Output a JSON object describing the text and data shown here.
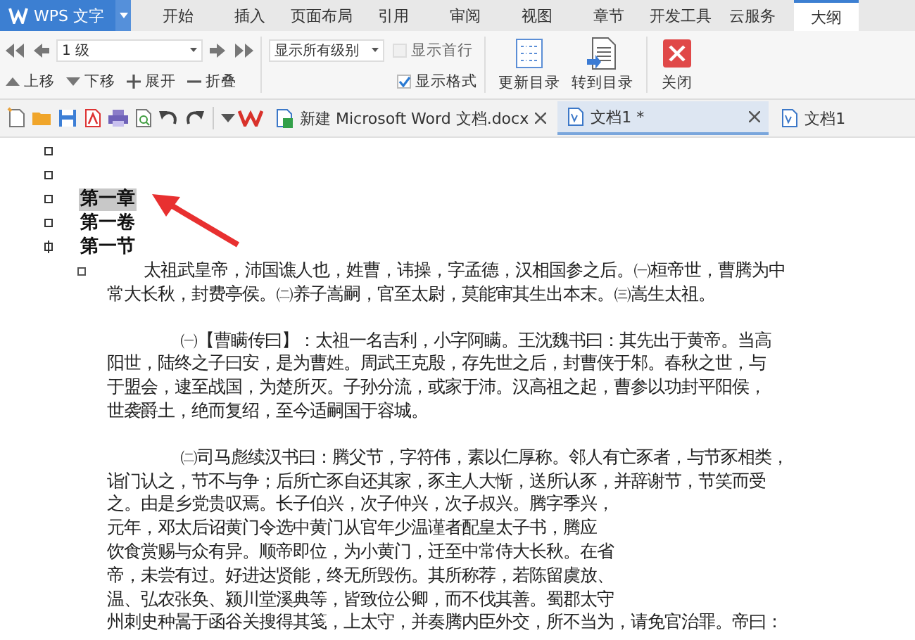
{
  "app_menu": {
    "label": "WPS 文字"
  },
  "ribbon_tabs": [
    {
      "label": "开始",
      "selected": false
    },
    {
      "label": "插入",
      "selected": false
    },
    {
      "label": "页面布局",
      "selected": false
    },
    {
      "label": "引用",
      "selected": false
    },
    {
      "label": "审阅",
      "selected": false
    },
    {
      "label": "视图",
      "selected": false
    },
    {
      "label": "章节",
      "selected": false
    },
    {
      "label": "开发工具",
      "selected": false
    },
    {
      "label": "云服务",
      "selected": false
    },
    {
      "label": "大纲",
      "selected": true
    }
  ],
  "outline_toolbar": {
    "level_select": {
      "value": "1 级"
    },
    "move_buttons": [
      {
        "kind": "up",
        "label": "上移"
      },
      {
        "kind": "down",
        "label": "下移"
      },
      {
        "kind": "expand",
        "label": "展开"
      },
      {
        "kind": "collapse",
        "label": "折叠"
      }
    ],
    "show_levels": {
      "value": "显示所有级别"
    },
    "checkboxes": [
      {
        "label": "显示首行",
        "checked": false,
        "disabled": true
      },
      {
        "label": "显示格式",
        "checked": true,
        "disabled": false
      }
    ],
    "big_buttons": [
      {
        "kind": "update",
        "label": "更新目录"
      },
      {
        "kind": "goto",
        "label": "转到目录"
      },
      {
        "kind": "close",
        "label": "关闭"
      }
    ]
  },
  "doc_tabs": [
    {
      "label": "新建 Microsoft Word 文档.docx",
      "selected": false,
      "closable": true
    },
    {
      "label": "文档1 *",
      "selected": true,
      "closable": true
    },
    {
      "label": "文档1",
      "selected": false,
      "closable": false
    }
  ],
  "outline": [
    {
      "kind": "empty"
    },
    {
      "kind": "empty"
    },
    {
      "kind": "heading",
      "text": "第一章",
      "selected": true
    },
    {
      "kind": "heading",
      "text": "第一卷",
      "selected": false
    },
    {
      "kind": "heading",
      "text": "第一节",
      "selected": false,
      "expandable": true
    },
    {
      "kind": "body",
      "paragraphs": [
        {
          "lines": [
            "太祖武皇帝，沛国谯人也，姓曹，讳操，字孟德，汉相国参之后。㈠桓帝世，曹腾为中",
            "常大长秋，封费亭侯。㈡养子嵩嗣，官至太尉，莫能审其生出本末。㈢嵩生太祖。"
          ]
        },
        {
          "lines": [
            "㈠【曹瞒传曰】：太祖一名吉利，小字阿瞒。王沈魏书曰：其先出于黄帝。当高",
            "阳世，陆终之子曰安，是为曹姓。周武王克殷，存先世之后，封曹侠于邾。春秋之世，与",
            "于盟会，逮至战国，为楚所灭。子孙分流，或家于沛。汉高祖之起，曹参以功封平阳侯，",
            "世袭爵土，绝而复绍，至今适嗣国于容城。"
          ]
        },
        {
          "lines": [
            "㈡司马彪续汉书曰：腾父节，字符伟，素以仁厚称。邻人有亡豕者，与节豕相类，",
            "诣门认之，节不与争；后所亡豕自还其家，豕主人大惭，送所认豕，并辞谢节，节笑而受",
            "之。由是乡党贵叹焉。长子伯兴，次子仲兴，次子叔兴。腾字季兴，",
            "元年，邓太后诏黄门令选中黄门从官年少温谨者配皇太子书，腾应",
            "饮食赏赐与众有异。顺帝即位，为小黄门，迁至中常侍大长秋。在省",
            "帝，未尝有过。好进达贤能，终无所毁伤。其所称荐，若陈留虞放、",
            "温、弘农张奂、颍川堂溪典等，皆致位公卿，而不伐其善。蜀郡太守",
            "州刺史种暠于函谷关搜得其笺，上太守，并奏腾内臣外交，所不当为，请免官治罪。帝曰："
          ]
        }
      ]
    }
  ]
}
